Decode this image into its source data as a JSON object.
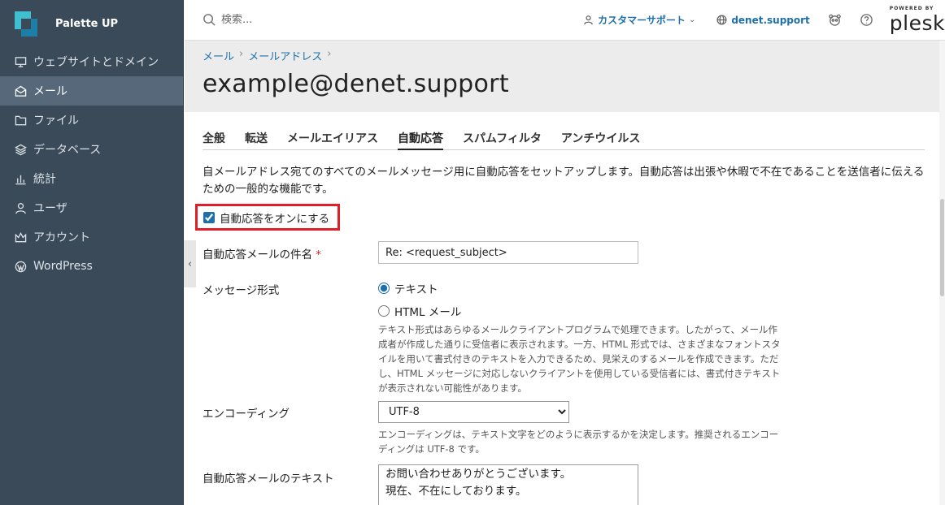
{
  "sidebar": {
    "brand": "Palette UP",
    "items": [
      {
        "label": "ウェブサイトとドメイン",
        "icon": "monitor-icon"
      },
      {
        "label": "メール",
        "icon": "mail-icon",
        "active": true
      },
      {
        "label": "ファイル",
        "icon": "folder-icon"
      },
      {
        "label": "データベース",
        "icon": "database-icon"
      },
      {
        "label": "統計",
        "icon": "bar-chart-icon"
      },
      {
        "label": "ユーザ",
        "icon": "user-icon"
      },
      {
        "label": "アカウント",
        "icon": "crown-icon"
      },
      {
        "label": "WordPress",
        "icon": "wordpress-icon"
      }
    ]
  },
  "topbar": {
    "search_placeholder": "検索...",
    "support_label": "カスタマーサポート",
    "domain_label": "denet.support",
    "plesk_small": "POWERED BY",
    "plesk_big": "plesk"
  },
  "header": {
    "breadcrumb": [
      "メール",
      "メールアドレス"
    ],
    "title": "example@denet.support"
  },
  "tabs": [
    "全般",
    "転送",
    "メールエイリアス",
    "自動応答",
    "スパムフィルタ",
    "アンチウイルス"
  ],
  "active_tab": "自動応答",
  "form": {
    "intro": "自メールアドレス宛てのすべてのメールメッセージ用に自動応答をセットアップします。自動応答は出張や休暇で不在であることを送信者に伝えるための一般的な機能です。",
    "toggle_label": "自動応答をオンにする",
    "toggle_checked": true,
    "subject_label": "自動応答メールの件名",
    "subject_required": "*",
    "subject_value": "Re: <request_subject>",
    "format_label": "メッセージ形式",
    "format_options": [
      "テキスト",
      "HTML メール"
    ],
    "format_selected": "テキスト",
    "format_hint": "テキスト形式はあらゆるメールクライアントプログラムで処理できます。したがって、メール作成者が作成した通りに受信者に表示されます。一方、HTML 形式では、さまざまなフォントスタイルを用いて書式付きのテキストを入力できるため、見栄えのするメールを作成できます。ただし、HTML メッセージに対応しないクライアントを使用している受信者には、書式付きテキストが表示されない可能性があります。",
    "encoding_label": "エンコーディング",
    "encoding_value": "UTF-8",
    "encoding_hint": "エンコーディングは、テキスト文字をどのように表示するかを決定します。推奨されるエンコーディングは UTF-8 です。",
    "text_label": "自動応答メールのテキスト",
    "text_value": "お問い合わせありがとうございます。\n現在、不在にしております。"
  },
  "colors": {
    "sidebar_bg": "#3b4a59",
    "sidebar_active": "#56687a",
    "link": "#1f6fa8",
    "highlight_border": "#e01e28"
  }
}
